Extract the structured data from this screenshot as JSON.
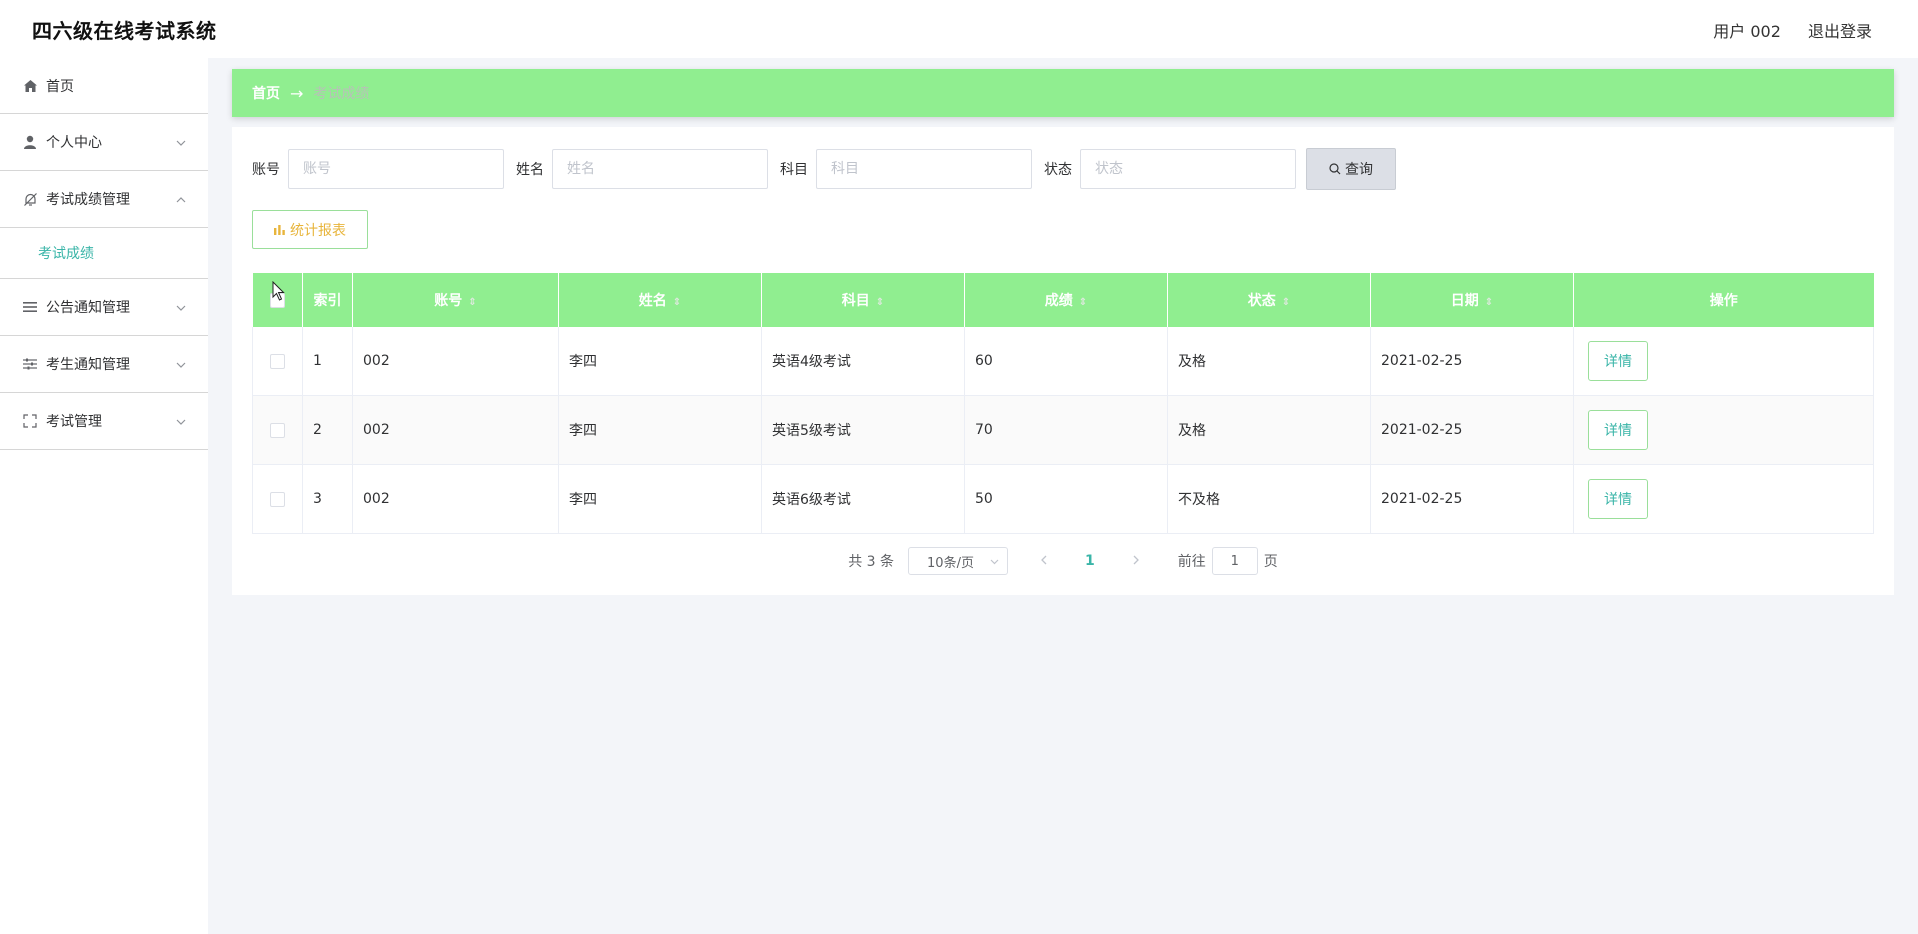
{
  "header": {
    "title": "四六级在线考试系统",
    "user": "用户 002",
    "logout": "退出登录"
  },
  "sidebar": {
    "items": [
      {
        "label": "首页",
        "icon": "home-icon"
      },
      {
        "label": "个人中心",
        "icon": "user-icon"
      },
      {
        "label": "考试成绩管理",
        "icon": "bell-off-icon",
        "expanded": true,
        "children": [
          "考试成绩"
        ]
      },
      {
        "label": "公告通知管理",
        "icon": "list-icon"
      },
      {
        "label": "考生通知管理",
        "icon": "sliders-icon"
      },
      {
        "label": "考试管理",
        "icon": "fullscreen-icon"
      }
    ]
  },
  "breadcrumb": {
    "home": "首页",
    "arrow": "→",
    "current": "考试成绩"
  },
  "search": {
    "fields": [
      {
        "label": "账号",
        "placeholder": "账号"
      },
      {
        "label": "姓名",
        "placeholder": "姓名"
      },
      {
        "label": "科目",
        "placeholder": "科目"
      },
      {
        "label": "状态",
        "placeholder": "状态"
      }
    ],
    "button": "查询"
  },
  "stats_button": "统计报表",
  "table": {
    "columns": [
      "索引",
      "账号",
      "姓名",
      "科目",
      "成绩",
      "状态",
      "日期",
      "操作"
    ],
    "rows": [
      {
        "index": "1",
        "account": "002",
        "name": "李四",
        "subject": "英语4级考试",
        "score": "60",
        "status": "及格",
        "date": "2021-02-25",
        "action": "详情"
      },
      {
        "index": "2",
        "account": "002",
        "name": "李四",
        "subject": "英语5级考试",
        "score": "70",
        "status": "及格",
        "date": "2021-02-25",
        "action": "详情"
      },
      {
        "index": "3",
        "account": "002",
        "name": "李四",
        "subject": "英语6级考试",
        "score": "50",
        "status": "不及格",
        "date": "2021-02-25",
        "action": "详情"
      }
    ]
  },
  "pagination": {
    "total": "共 3 条",
    "page_size": "10条/页",
    "current_page": "1",
    "goto_prefix": "前往",
    "goto_value": "1",
    "goto_suffix": "页"
  },
  "colors": {
    "accent": "#90ee90",
    "link": "#3ab5a8",
    "stats": "#e8b53c"
  }
}
